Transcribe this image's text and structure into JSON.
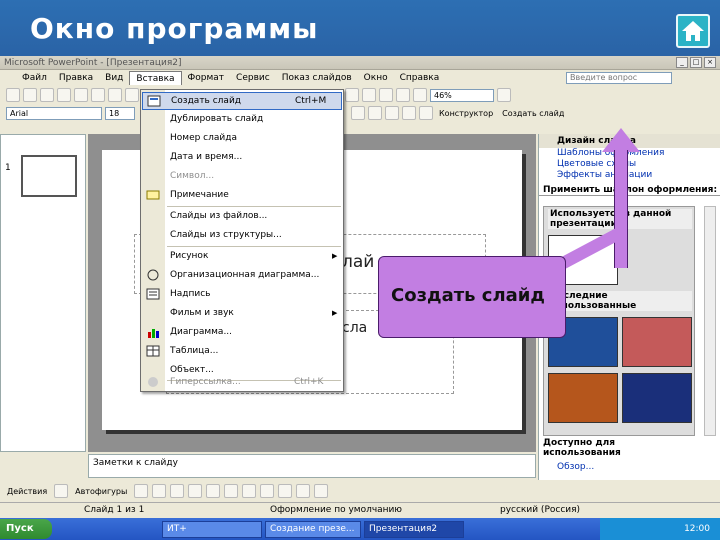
{
  "slide": {
    "title": "Окно программы",
    "home_icon": "home-icon",
    "callout": "Создать слайд",
    "accent": "#2d6fb3",
    "callout_color": "#c27ee2"
  },
  "app": {
    "window_title": "Microsoft PowerPoint - [Презентация2]",
    "menus": [
      "Файл",
      "Правка",
      "Вид",
      "Вставка",
      "Формат",
      "Сервис",
      "Показ слайдов",
      "Окно",
      "Справка"
    ],
    "active_menu": "Вставка",
    "ask_placeholder": "Введите вопрос",
    "zoom": "46%",
    "font_name": "Arial",
    "font_size": "18",
    "toolbar_designer": "Конструктор",
    "toolbar_new_slide": "Создать слайд"
  },
  "insert_menu": [
    {
      "label": "Создать слайд",
      "shortcut": "Ctrl+M",
      "highlighted": true,
      "icon": "new-slide-icon"
    },
    {
      "label": "Дублировать слайд"
    },
    {
      "label": "Номер слайда"
    },
    {
      "label": "Дата и время..."
    },
    {
      "label": "Символ...",
      "disabled": true
    },
    {
      "label": "Примечание",
      "icon": "comment-icon"
    },
    {
      "label": "Слайды из файлов..."
    },
    {
      "label": "Слайды из структуры..."
    },
    {
      "label": "Рисунок",
      "submenu": true
    },
    {
      "label": "Организационная диаграмма...",
      "icon": "org-chart-icon"
    },
    {
      "label": "Надпись",
      "icon": "textbox-icon"
    },
    {
      "label": "Фильм и звук",
      "submenu": true
    },
    {
      "label": "Диаграмма...",
      "icon": "chart-icon"
    },
    {
      "label": "Таблица...",
      "icon": "table-icon"
    },
    {
      "label": "Объект..."
    },
    {
      "label": "Гиперссылка...",
      "shortcut": "Ctrl+K",
      "disabled": true,
      "icon": "hyperlink-icon"
    }
  ],
  "slides_pane": {
    "thumb_number": "1"
  },
  "slide_canvas": {
    "title_fragment": "лай",
    "body_fragment": "сла"
  },
  "notes": "Заметки к слайду",
  "task_pane": {
    "title": "Дизайн слайда",
    "links": [
      "Шаблоны оформления",
      "Цветовые схемы",
      "Эффекты анимации"
    ],
    "apply_label": "Применить шаблон оформления:",
    "used_caption": "Используется в данной презентации",
    "recent_caption": "Последние использованные",
    "available_caption": "Доступно для использования",
    "browse": "Обзор..."
  },
  "draw_toolbar": {
    "actions": "Действия",
    "autoshapes": "Автофигуры"
  },
  "status": {
    "slide": "Слайд 1 из 1",
    "design": "Оформление по умолчанию",
    "lang": "русский (Россия)"
  },
  "taskbar": {
    "start": "Пуск",
    "items": [
      "ИТ+",
      "Создание презе...",
      "Презентация2"
    ],
    "clock": "12:00"
  }
}
